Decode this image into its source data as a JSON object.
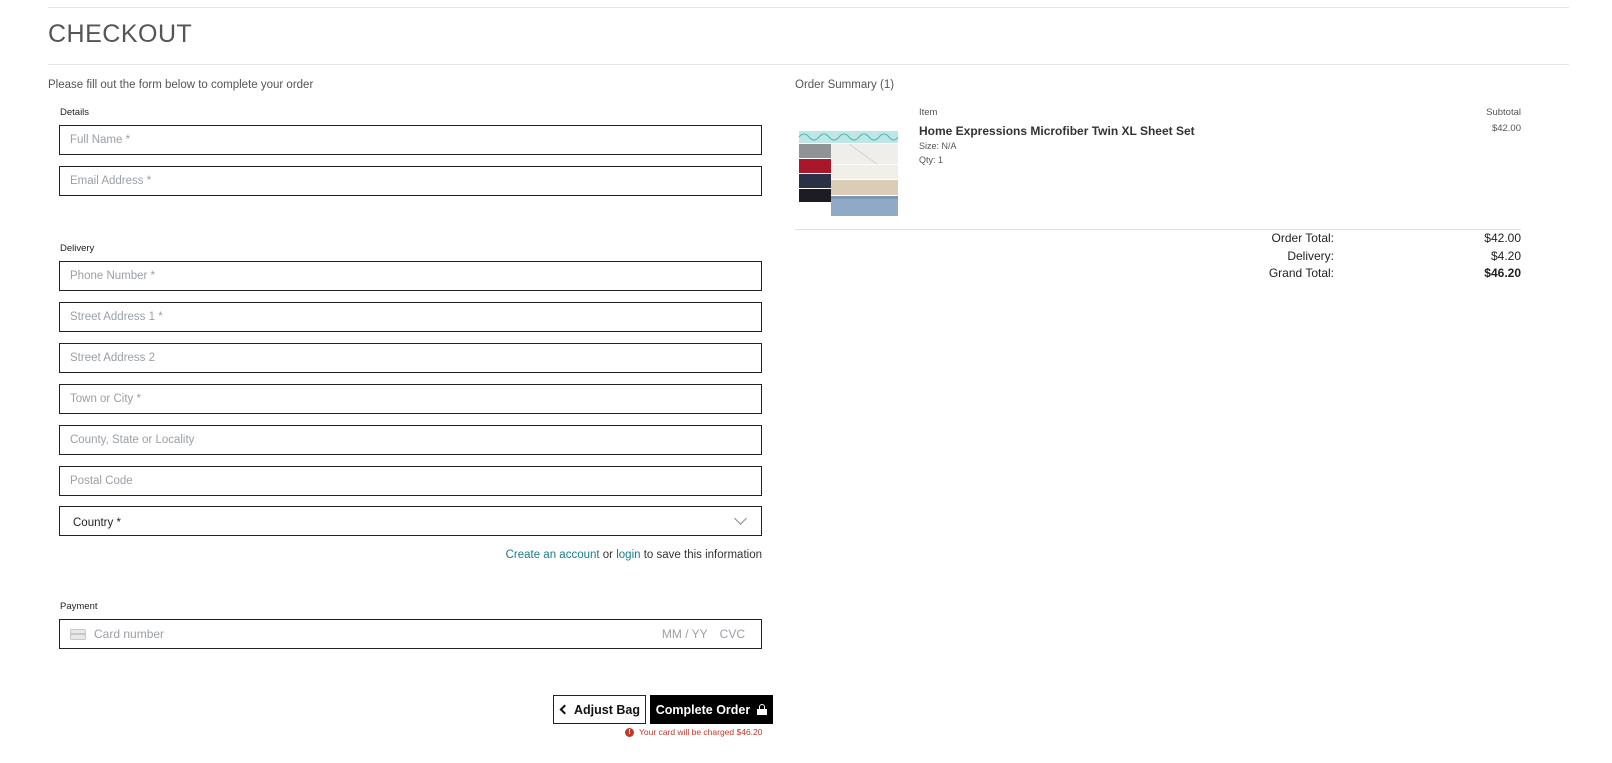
{
  "header": {
    "title": "CHECKOUT"
  },
  "form": {
    "intro": "Please fill out the form below to complete your order",
    "details_label": "Details",
    "delivery_label": "Delivery",
    "payment_label": "Payment",
    "fields": {
      "full_name": {
        "placeholder": "Full Name *",
        "value": ""
      },
      "email": {
        "placeholder": "Email Address *",
        "value": ""
      },
      "phone": {
        "placeholder": "Phone Number *",
        "value": ""
      },
      "street1": {
        "placeholder": "Street Address 1 *",
        "value": ""
      },
      "street2": {
        "placeholder": "Street Address 2",
        "value": ""
      },
      "town": {
        "placeholder": "Town or City *",
        "value": ""
      },
      "county": {
        "placeholder": "County, State or Locality",
        "value": ""
      },
      "postcode": {
        "placeholder": "Postal Code",
        "value": ""
      },
      "country": {
        "placeholder": "Country *"
      }
    },
    "account": {
      "create_link": "Create an account",
      "or_text": "or",
      "login_link": "login",
      "suffix": "to save this information"
    },
    "card": {
      "number_placeholder": "Card number",
      "expiry_placeholder": "MM / YY",
      "cvc_placeholder": "CVC",
      "icon": "card-icon"
    },
    "buttons": {
      "adjust_bag": "Adjust Bag",
      "complete_order": "Complete Order"
    },
    "charge_note": "Your card will be charged $46.20"
  },
  "summary": {
    "title": "Order Summary (1)",
    "col_item": "Item",
    "col_subtotal": "Subtotal",
    "product": {
      "name": "Home Expressions Microfiber Twin XL Sheet Set",
      "size": "Size: N/A",
      "qty": "Qty: 1",
      "price": "$42.00"
    },
    "totals": {
      "order_total_label": "Order Total:",
      "order_total": "$42.00",
      "delivery_label": "Delivery:",
      "delivery": "$4.20",
      "grand_total_label": "Grand Total:",
      "grand_total": "$46.20"
    }
  },
  "colors": {
    "link": "#1a7a8c",
    "error": "#c0392b",
    "primary_button": "#000000"
  }
}
